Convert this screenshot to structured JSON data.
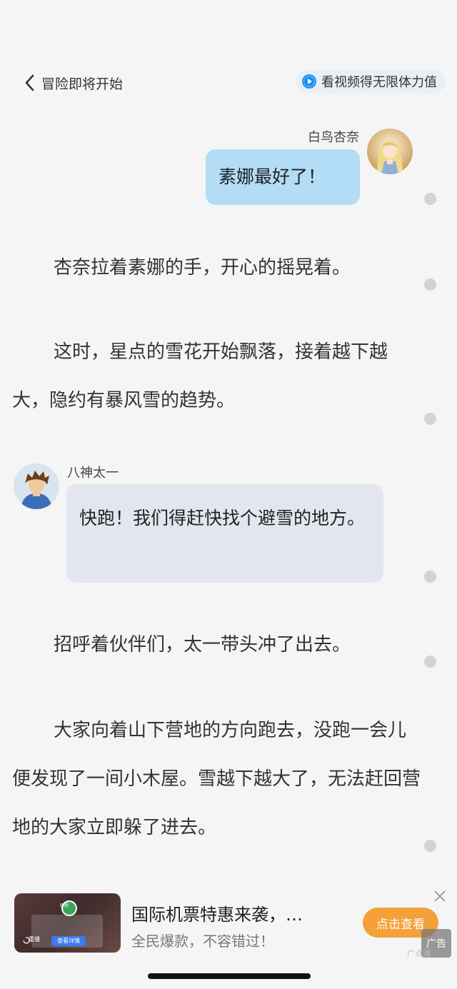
{
  "header": {
    "back_label": "冒险即将开始",
    "video_label": "看视频得无限体力值"
  },
  "messages": [
    {
      "side": "right",
      "speaker": "白鸟杏奈",
      "text": "素娜最好了！"
    },
    {
      "side": "left",
      "speaker": "八神太一",
      "text": "快跑！我们得赶快找个避雪的地方。"
    }
  ],
  "paragraphs": [
    "杏奈拉着素娜的手，开心的摇晃着。",
    "这时，星点的雪花开始飘落，接着越下越大，隐约有暴风雪的趋势。",
    "招呼着伙伴们，太一带头冲了出去。",
    "大家向着山下营地的方向跑去，没跑一会儿便发现了一间小木屋。雪越下越大了，无法赶回营地的大家立即躲了进去。"
  ],
  "ad": {
    "title": "国际机票特惠来袭，…",
    "subtitle": "全民爆款，不容错过！",
    "button_label": "点击查看",
    "tag": "广告",
    "tag_small": "广点通",
    "thumb_brand": "同程",
    "thumb_button": "查看详情",
    "thumb_replay": "重播"
  },
  "colors": {
    "background": "#f5f5f5",
    "right_bubble": "#b3dcf6",
    "left_bubble": "#e3e6ef",
    "ad_button": "#f5a13a",
    "play_icon": "#1a8ef5"
  }
}
